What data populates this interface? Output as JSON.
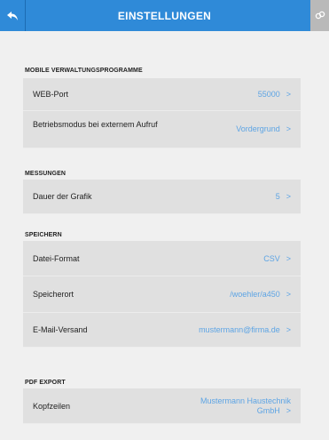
{
  "header": {
    "title": "EINSTELLUNGEN",
    "back_icon": "back-arrow-icon",
    "link_icon": "link-icon"
  },
  "colors": {
    "header_bg": "#2f8ad8",
    "value_text": "#5da4e4",
    "row_bg": "#e0e0e0",
    "page_bg": "#f0f0f0"
  },
  "sections": {
    "mobile": {
      "title": "MOBILE VERWALTUNGSPROGRAMME",
      "web_port": {
        "label": "WEB-Port",
        "value": "55000",
        "chevron": ">"
      },
      "betriebsmodus": {
        "label": "Betriebsmodus bei externem Aufruf",
        "value": "Vordergrund",
        "chevron": ">"
      }
    },
    "messungen": {
      "title": "MESSUNGEN",
      "dauer": {
        "label": "Dauer der Grafik",
        "value": "5",
        "chevron": ">"
      }
    },
    "speichern": {
      "title": "SPEICHERN",
      "dateiformat": {
        "label": "Datei-Format",
        "value": "CSV",
        "chevron": ">"
      },
      "speicherort": {
        "label": "Speicherort",
        "value": "/woehler/a450",
        "chevron": ">"
      },
      "email": {
        "label": "E-Mail-Versand",
        "value": "mustermann@firma.de",
        "chevron": ">"
      }
    },
    "pdf": {
      "title": "PDF EXPORT",
      "kopfzeilen": {
        "label": "Kopfzeilen",
        "value_line1": "Mustermann Haustechnik",
        "value_line2": "GmbH",
        "chevron": ">"
      }
    }
  }
}
